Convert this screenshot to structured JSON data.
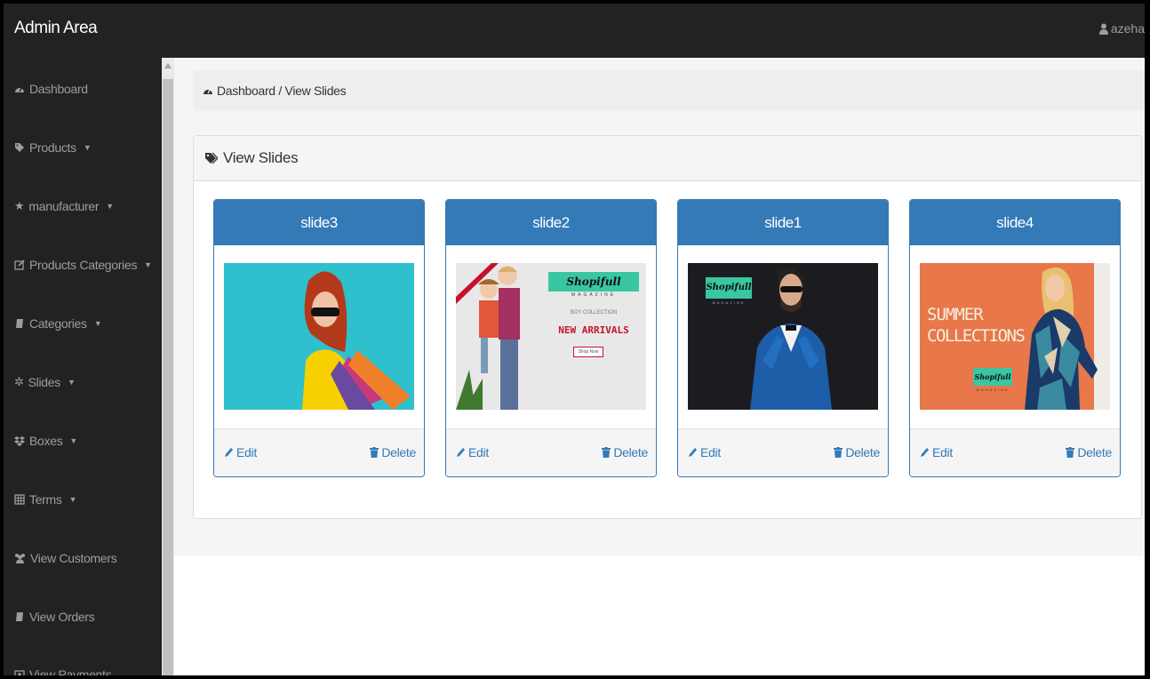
{
  "app": {
    "brand": "Admin Area",
    "user": "azeha"
  },
  "sidebar": {
    "items": [
      {
        "label": "Dashboard",
        "icon": "dashboard-icon",
        "caret": false
      },
      {
        "label": "Products",
        "icon": "tag-icon",
        "caret": true
      },
      {
        "label": "manufacturer",
        "icon": "star-icon",
        "caret": true
      },
      {
        "label": "Products Categories",
        "icon": "edit-icon",
        "caret": true
      },
      {
        "label": "Categories",
        "icon": "book-icon",
        "caret": true
      },
      {
        "label": "Slides",
        "icon": "gear-icon",
        "caret": true
      },
      {
        "label": "Boxes",
        "icon": "dropbox-icon",
        "caret": true
      },
      {
        "label": "Terms",
        "icon": "table-icon",
        "caret": true
      },
      {
        "label": "View Customers",
        "icon": "users-icon",
        "caret": false
      },
      {
        "label": "View Orders",
        "icon": "book-icon",
        "caret": false
      },
      {
        "label": "View Payments",
        "icon": "money-icon",
        "caret": false
      }
    ]
  },
  "breadcrumb": {
    "text": "Dashboard / View Slides"
  },
  "panel": {
    "title": "View Slides"
  },
  "slides": [
    {
      "name": "slide3",
      "edit": "Edit",
      "delete": "Delete"
    },
    {
      "name": "slide2",
      "edit": "Edit",
      "delete": "Delete",
      "image_text": {
        "brand": "Shopifull",
        "sub": "MAGAZINE",
        "line1": "BOY COLLECTION",
        "line2": "NEW ARRIVALS",
        "button": "Shop Now"
      }
    },
    {
      "name": "slide1",
      "edit": "Edit",
      "delete": "Delete",
      "image_text": {
        "brand": "Shopifull",
        "sub": "MAGAZINE"
      }
    },
    {
      "name": "slide4",
      "edit": "Edit",
      "delete": "Delete",
      "image_text": {
        "line1": "SUMMER",
        "line2": "COLLECTIONS",
        "brand": "Shopifull",
        "sub": "MAGAZINE"
      }
    }
  ],
  "colors": {
    "navbar": "#222222",
    "primary": "#337ab7",
    "link": "#337ab7",
    "content_bg": "#f5f5f5"
  }
}
